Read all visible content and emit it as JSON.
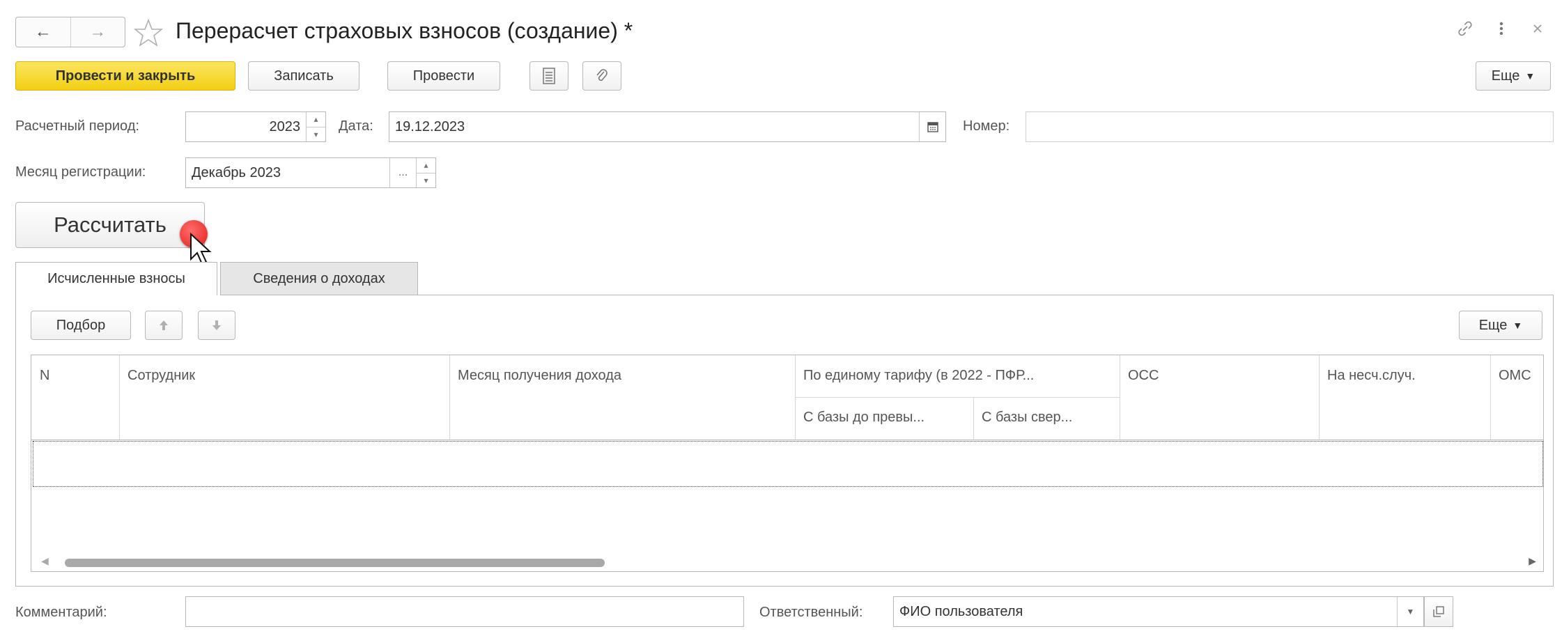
{
  "window": {
    "title": "Перерасчет страховых взносов (создание) *",
    "nav_back": "←",
    "nav_forward": "→"
  },
  "toolbar": {
    "post_close_label": "Провести и закрыть",
    "save_label": "Записать",
    "post_label": "Провести",
    "more_label": "Еще"
  },
  "form": {
    "period_label": "Расчетный период:",
    "period_value": "2023",
    "date_label": "Дата:",
    "date_value": "19.12.2023",
    "number_label": "Номер:",
    "number_value": "",
    "reg_month_label": "Месяц регистрации:",
    "reg_month_value": "Декабрь 2023",
    "reg_month_select": "...",
    "calculate_label": "Рассчитать"
  },
  "tabs": [
    {
      "label": "Исчисленные взносы",
      "active": true
    },
    {
      "label": "Сведения о доходах",
      "active": false
    }
  ],
  "table_toolbar": {
    "select_label": "Подбор",
    "more_label": "Еще"
  },
  "table": {
    "columns": {
      "n": "N",
      "employee": "Сотрудник",
      "income_month": "Месяц получения дохода",
      "single_tariff": "По единому тарифу (в 2022 - ПФР...",
      "base_below": "С базы до превы...",
      "base_above": "С базы свер...",
      "oss": "ОСС",
      "accident": "На несч.случ.",
      "oms": "ОМС"
    },
    "rows": []
  },
  "footer": {
    "comment_label": "Комментарий:",
    "comment_value": "",
    "responsible_label": "Ответственный:",
    "responsible_value": "ФИО пользователя"
  },
  "colors": {
    "primary_button": "#f3cf14",
    "border": "#b8b8b8",
    "cursor_marker": "#e0201c"
  }
}
